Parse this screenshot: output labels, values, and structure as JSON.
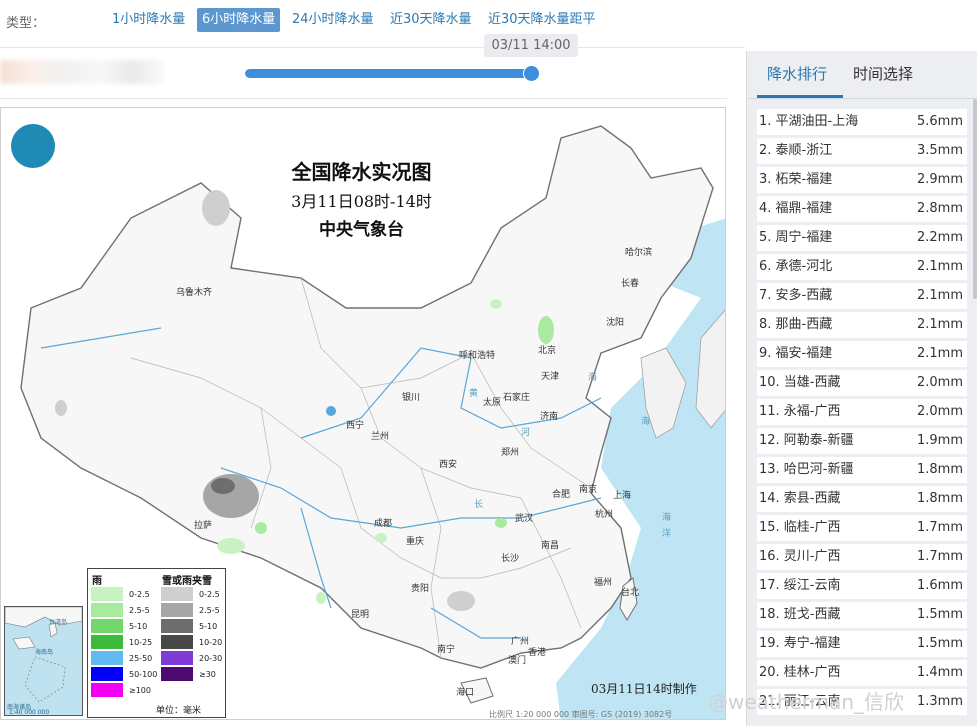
{
  "type_bar": {
    "label": "类型：",
    "tabs": [
      {
        "label": "1小时降水量",
        "active": false
      },
      {
        "label": "6小时降水量",
        "active": true
      },
      {
        "label": "24小时降水量",
        "active": false
      },
      {
        "label": "近30天降水量",
        "active": false
      },
      {
        "label": "近30天降水量距平",
        "active": false
      }
    ]
  },
  "slider": {
    "time_label": "03/11 14:00",
    "progress": 1.0
  },
  "map": {
    "title": "全国降水实况图",
    "subtitle": "3月11日08时-14时",
    "issuer": "中央气象台",
    "produced": "03月11日14时制作",
    "scale_note": "比例尺 1:20 000 000   审图号: GS (2019) 3082号",
    "cities": [
      {
        "name": "乌鲁木齐"
      },
      {
        "name": "哈尔滨"
      },
      {
        "name": "长春"
      },
      {
        "name": "沈阳"
      },
      {
        "name": "呼和浩特"
      },
      {
        "name": "北京"
      },
      {
        "name": "天津"
      },
      {
        "name": "银川"
      },
      {
        "name": "太原"
      },
      {
        "name": "石家庄"
      },
      {
        "name": "济南"
      },
      {
        "name": "西宁"
      },
      {
        "name": "兰州"
      },
      {
        "name": "郑州"
      },
      {
        "name": "西安"
      },
      {
        "name": "合肥"
      },
      {
        "name": "南京"
      },
      {
        "name": "上海"
      },
      {
        "name": "杭州"
      },
      {
        "name": "拉萨"
      },
      {
        "name": "成都"
      },
      {
        "name": "武汉"
      },
      {
        "name": "重庆"
      },
      {
        "name": "南昌"
      },
      {
        "name": "长沙"
      },
      {
        "name": "贵阳"
      },
      {
        "name": "福州"
      },
      {
        "name": "台北"
      },
      {
        "name": "昆明"
      },
      {
        "name": "南宁"
      },
      {
        "name": "广州"
      },
      {
        "name": "香港"
      },
      {
        "name": "澳门"
      },
      {
        "name": "海口"
      }
    ],
    "seas": [
      "海",
      "海",
      "海",
      "洋",
      "黄",
      "河",
      "长"
    ],
    "legend": {
      "rain_title": "雨",
      "snow_title": "雪或雨夹雪",
      "unit": "单位：毫米",
      "rain": [
        {
          "range": "0-2.5",
          "color": "#c9f2c2"
        },
        {
          "range": "2.5-5",
          "color": "#a8eaa0"
        },
        {
          "range": "5-10",
          "color": "#73d86b"
        },
        {
          "range": "10-25",
          "color": "#3dba3b"
        },
        {
          "range": "25-50",
          "color": "#62b8f0"
        },
        {
          "range": "50-100",
          "color": "#0000f7"
        },
        {
          "range": "≥100",
          "color": "#f200f2"
        }
      ],
      "snow": [
        {
          "range": "0-2.5",
          "color": "#cfcfcf"
        },
        {
          "range": "2.5-5",
          "color": "#a6a6a6"
        },
        {
          "range": "5-10",
          "color": "#6e6e6e"
        },
        {
          "range": "10-20",
          "color": "#484848"
        },
        {
          "range": "20-30",
          "color": "#7f3bd8"
        },
        {
          "range": "≥30",
          "color": "#4b0b6e"
        }
      ]
    },
    "inset": {
      "labels": [
        "南海诸岛",
        "台湾岛",
        "海南岛",
        "1:40 000 000"
      ]
    }
  },
  "panel": {
    "tabs": [
      {
        "label": "降水排行",
        "active": true
      },
      {
        "label": "时间选择",
        "active": false
      }
    ],
    "ranking": [
      {
        "label": "1. 平湖油田-上海",
        "value": "5.6mm"
      },
      {
        "label": "2. 泰顺-浙江",
        "value": "3.5mm"
      },
      {
        "label": "3. 柘荣-福建",
        "value": "2.9mm"
      },
      {
        "label": "4. 福鼎-福建",
        "value": "2.8mm"
      },
      {
        "label": "5. 周宁-福建",
        "value": "2.2mm"
      },
      {
        "label": "6. 承德-河北",
        "value": "2.1mm"
      },
      {
        "label": "7. 安多-西藏",
        "value": "2.1mm"
      },
      {
        "label": "8. 那曲-西藏",
        "value": "2.1mm"
      },
      {
        "label": "9. 福安-福建",
        "value": "2.1mm"
      },
      {
        "label": "10. 当雄-西藏",
        "value": "2.0mm"
      },
      {
        "label": "11. 永福-广西",
        "value": "2.0mm"
      },
      {
        "label": "12. 阿勒泰-新疆",
        "value": "1.9mm"
      },
      {
        "label": "13. 哈巴河-新疆",
        "value": "1.8mm"
      },
      {
        "label": "14. 索县-西藏",
        "value": "1.8mm"
      },
      {
        "label": "15. 临桂-广西",
        "value": "1.7mm"
      },
      {
        "label": "16. 灵川-广西",
        "value": "1.7mm"
      },
      {
        "label": "17. 绥江-云南",
        "value": "1.6mm"
      },
      {
        "label": "18. 班戈-西藏",
        "value": "1.5mm"
      },
      {
        "label": "19. 寿宁-福建",
        "value": "1.5mm"
      },
      {
        "label": "20. 桂林-广西",
        "value": "1.4mm"
      },
      {
        "label": "21. 丽江-云南",
        "value": "1.3mm"
      }
    ]
  },
  "watermark": "@weatherman_信欣"
}
